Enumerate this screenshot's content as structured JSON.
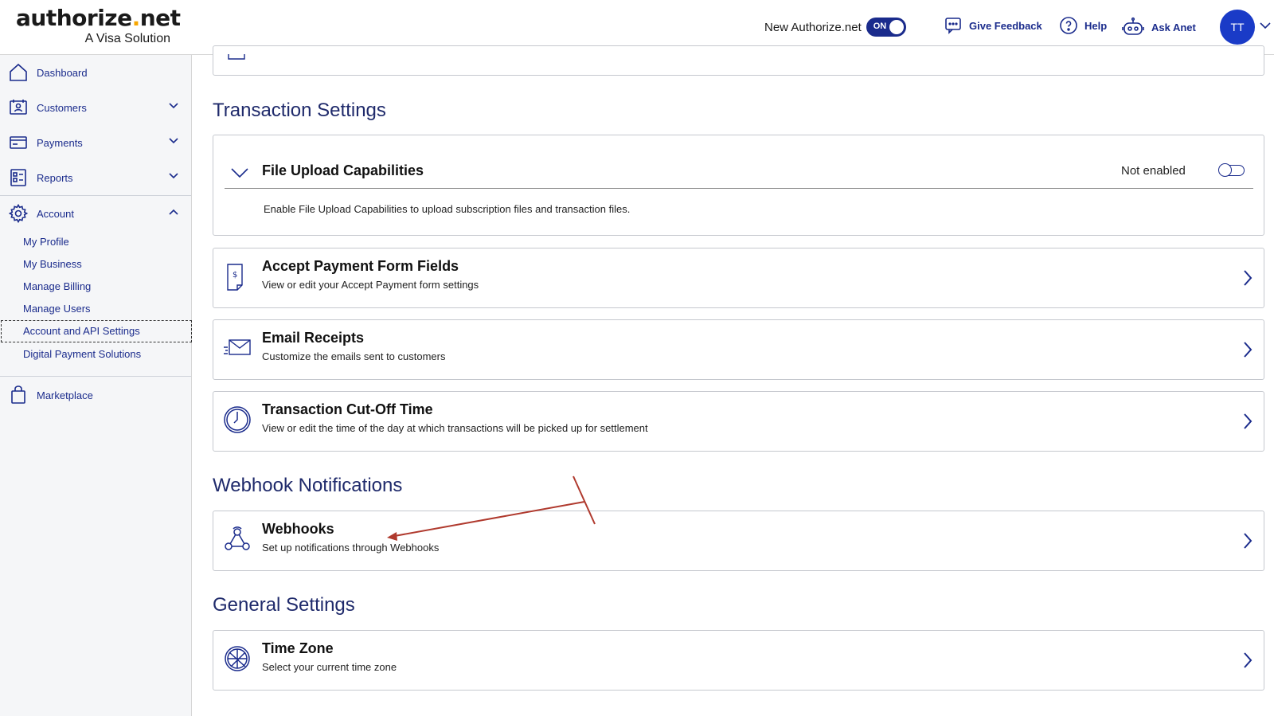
{
  "header": {
    "logo_text_main": "authorize",
    "logo_text_dot": ".",
    "logo_text_end": "net",
    "logo_sub": "A Visa Solution",
    "toggle_label": "New Authorize.net",
    "toggle_state": "ON",
    "feedback_label": "Give Feedback",
    "help_label": "Help",
    "ask_label": "Ask Anet",
    "avatar_initials": "TT"
  },
  "sidebar": {
    "items": [
      {
        "label": "Dashboard",
        "icon": "home-icon"
      },
      {
        "label": "Customers",
        "icon": "customers-icon"
      },
      {
        "label": "Payments",
        "icon": "payments-icon"
      },
      {
        "label": "Reports",
        "icon": "reports-icon"
      },
      {
        "label": "Account",
        "icon": "gear-icon"
      },
      {
        "label": "Marketplace",
        "icon": "shopping-bag-icon"
      }
    ],
    "account_sub": [
      "My Profile",
      "My Business",
      "Manage Billing",
      "Manage Users",
      "Account and API Settings",
      "Digital Payment Solutions"
    ]
  },
  "main": {
    "transaction_settings_title": "Transaction Settings",
    "file_upload": {
      "title": "File Upload Capabilities",
      "status": "Not enabled",
      "description": "Enable File Upload Capabilities to upload subscription files and transaction files."
    },
    "cards": [
      {
        "title": "Accept Payment Form Fields",
        "desc": "View or edit your Accept Payment form settings"
      },
      {
        "title": "Email Receipts",
        "desc": "Customize the emails sent to customers"
      },
      {
        "title": "Transaction Cut-Off Time",
        "desc": "View or edit the time of the day at which transactions will be picked up for settlement"
      }
    ],
    "webhook_title": "Webhook Notifications",
    "webhooks": {
      "title": "Webhooks",
      "desc": "Set up notifications through Webhooks"
    },
    "general_title": "General Settings",
    "time_zone": {
      "title": "Time Zone",
      "desc": "Select your current time zone"
    }
  },
  "colors": {
    "brand_navy": "#1a2b8c",
    "section_title": "#1f2a6b",
    "logo_dot": "#f7a600",
    "avatar": "#1a3bc7",
    "annotation_arrow": "#b03a2e"
  }
}
